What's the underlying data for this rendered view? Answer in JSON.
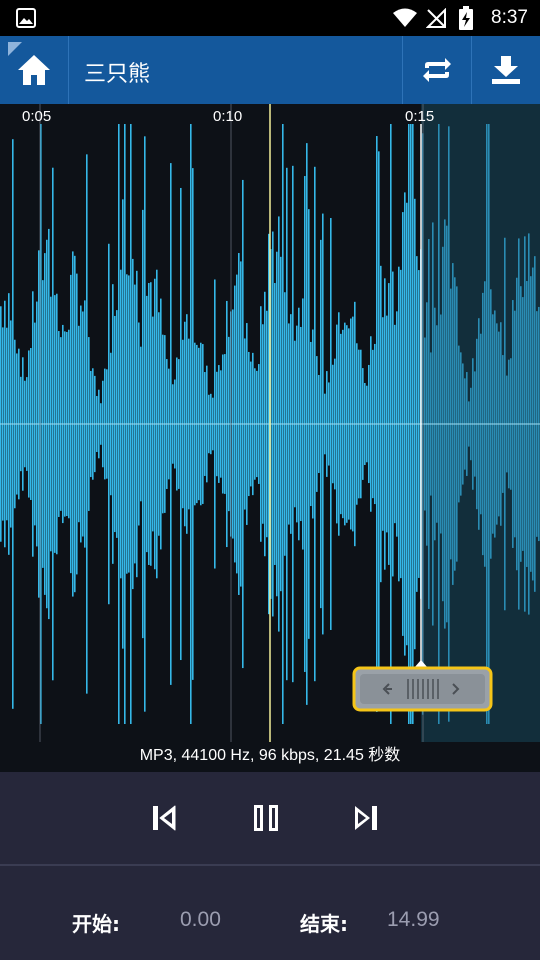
{
  "status_bar": {
    "time": "8:37"
  },
  "toolbar": {
    "title": "三只熊"
  },
  "waveform": {
    "time_labels": [
      "0:05",
      "0:10",
      "0:15"
    ],
    "selection_end_marker_seconds": 14.99,
    "colors": {
      "wave": "#35b8e8",
      "background": "#0d1117",
      "unselected_overlay": "#1a4a5c",
      "handle_border": "#f5c518"
    }
  },
  "file_info": "MP3, 44100 Hz, 96 kbps, 21.45 秒数",
  "controls": {
    "icons": [
      "skip-previous-icon",
      "pause-icon",
      "skip-next-icon"
    ]
  },
  "range": {
    "start_label": "开始:",
    "start_value": "0.00",
    "end_label": "结束:",
    "end_value": "14.99"
  }
}
